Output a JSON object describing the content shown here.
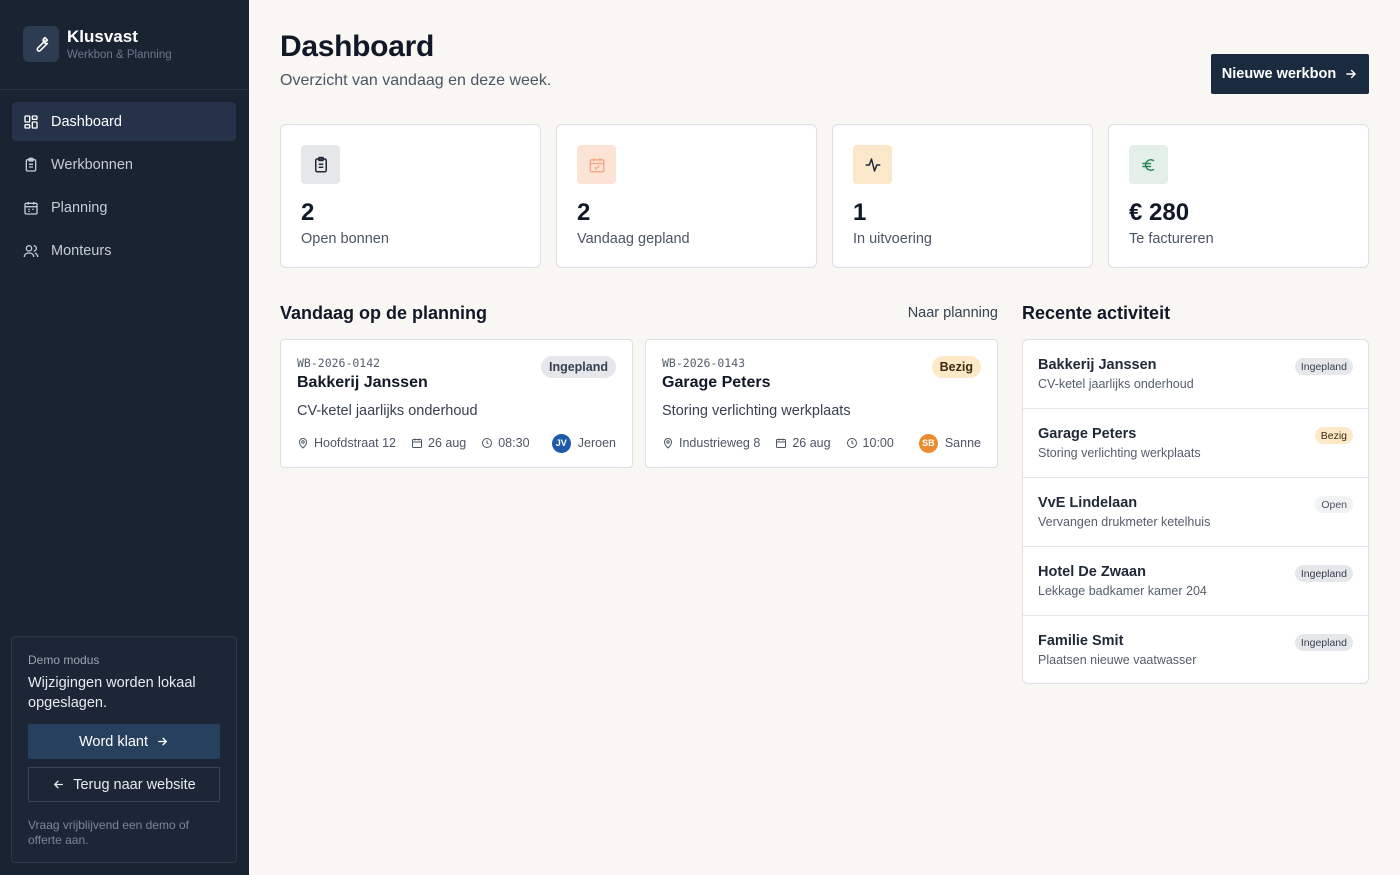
{
  "brand": {
    "name": "Klusvast",
    "subtitle": "Werkbon & Planning"
  },
  "nav": [
    {
      "label": "Dashboard",
      "icon": "dashboard-icon",
      "active": true
    },
    {
      "label": "Werkbonnen",
      "icon": "clipboard-icon"
    },
    {
      "label": "Planning",
      "icon": "calendar-icon"
    },
    {
      "label": "Monteurs",
      "icon": "users-icon"
    }
  ],
  "demo": {
    "label": "Demo modus",
    "text": "Wijzigingen worden lokaal opgeslagen.",
    "primary_button": "Word klant",
    "secondary_button": "Terug naar website",
    "footnote": "Vraag vrijblijvend een demo of offerte aan."
  },
  "header": {
    "title": "Dashboard",
    "subtitle": "Overzicht van vandaag en deze week.",
    "new_button": "Nieuwe werkbon"
  },
  "stats": [
    {
      "value": "2",
      "label": "Open bonnen",
      "icon": "clipboard-icon",
      "bg": "#e5e7eb",
      "color": "#1f2937"
    },
    {
      "value": "2",
      "label": "Vandaag gepland",
      "icon": "calendar-check-icon",
      "bg": "#fbe3d6",
      "color": "#f3a98a"
    },
    {
      "value": "1",
      "label": "In uitvoering",
      "icon": "activity-icon",
      "bg": "#fbe7c9",
      "color": "#1f2937"
    },
    {
      "value": "€ 280",
      "label": "Te factureren",
      "icon": "euro-icon",
      "bg": "#e3efe8",
      "color": "#2f855a"
    }
  ],
  "planning": {
    "title": "Vandaag op de planning",
    "link": "Naar planning",
    "jobs": [
      {
        "code": "WB-2026-0142",
        "name": "Bakkerij Janssen",
        "status": "Ingepland",
        "description": "CV-ketel jaarlijks onderhoud",
        "address": "Hoofdstraat 12",
        "date": "26 aug",
        "time": "08:30",
        "initials": "JV",
        "assignee": "Jeroen",
        "avatar_color": "#1e5aa8"
      },
      {
        "code": "WB-2026-0143",
        "name": "Garage Peters",
        "status": "Bezig",
        "description": "Storing verlichting werkplaats",
        "address": "Industrieweg 8",
        "date": "26 aug",
        "time": "10:00",
        "initials": "SB",
        "assignee": "Sanne",
        "avatar_color": "#ec8a2f"
      }
    ]
  },
  "activity": {
    "title": "Recente activiteit",
    "items": [
      {
        "name": "Bakkerij Janssen",
        "description": "CV-ketel jaarlijks onderhoud",
        "status": "Ingepland"
      },
      {
        "name": "Garage Peters",
        "description": "Storing verlichting werkplaats",
        "status": "Bezig"
      },
      {
        "name": "VvE Lindelaan",
        "description": "Vervangen drukmeter ketelhuis",
        "status": "Open"
      },
      {
        "name": "Hotel De Zwaan",
        "description": "Lekkage badkamer kamer 204",
        "status": "Ingepland"
      },
      {
        "name": "Familie Smit",
        "description": "Plaatsen nieuwe vaatwasser",
        "status": "Ingepland"
      }
    ]
  },
  "status_colors": {
    "Ingepland": {
      "bg": "#e5e7eb",
      "fg": "#374151"
    },
    "Bezig": {
      "bg": "#fde9c8",
      "fg": "#3b2a10"
    },
    "Open": {
      "bg": "#f1f2f4",
      "fg": "#4b5563"
    }
  }
}
